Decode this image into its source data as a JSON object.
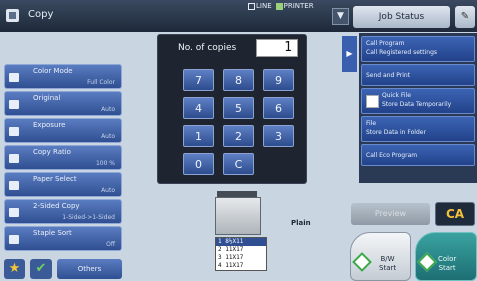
{
  "header": {
    "mode_title": "Copy",
    "status_line": "LINE",
    "status_printer": "PRINTER",
    "job_status": "Job Status"
  },
  "sidebar": {
    "items": [
      {
        "label": "Color Mode",
        "value": "Full Color"
      },
      {
        "label": "Original",
        "value": "Auto"
      },
      {
        "label": "Exposure",
        "value": "Auto"
      },
      {
        "label": "Copy Ratio",
        "value": "100 %"
      },
      {
        "label": "Paper Select",
        "value": "Auto"
      },
      {
        "label": "2-Sided Copy",
        "value": "1-Sided->1-Sided"
      },
      {
        "label": "Staple Sort",
        "value": "Off"
      }
    ],
    "others": "Others"
  },
  "keypad": {
    "copies_label": "No. of copies",
    "copies_value": "1",
    "keys": [
      "7",
      "8",
      "9",
      "4",
      "5",
      "6",
      "1",
      "2",
      "3",
      "0",
      "C"
    ]
  },
  "programs": {
    "items": [
      {
        "line1": "Call Program",
        "line2": "Call Registered settings"
      },
      {
        "line1": "Send and Print",
        "line2": ""
      },
      {
        "line1": "Quick File",
        "line2": "Store Data Temporarily"
      },
      {
        "line1": "File",
        "line2": "Store Data in Folder"
      },
      {
        "line1": "Call Eco Program",
        "line2": ""
      }
    ]
  },
  "actions": {
    "preview": "Preview",
    "ca": "CA",
    "bw_start_line1": "B/W",
    "bw_start_line2": "Start",
    "color_start_line1": "Color",
    "color_start_line2": "Start"
  },
  "machine": {
    "paper_type": "Plain",
    "trays": [
      {
        "num": "1",
        "size": "8½X11",
        "selected": true
      },
      {
        "num": "2",
        "size": "11X17",
        "selected": false
      },
      {
        "num": "3",
        "size": "11X17",
        "selected": false
      },
      {
        "num": "4",
        "size": "11X17",
        "selected": false
      }
    ]
  },
  "colors": {
    "accent": "#2f4f92",
    "start_green": "#3aa84a",
    "ca_yellow": "#f3c23a"
  }
}
